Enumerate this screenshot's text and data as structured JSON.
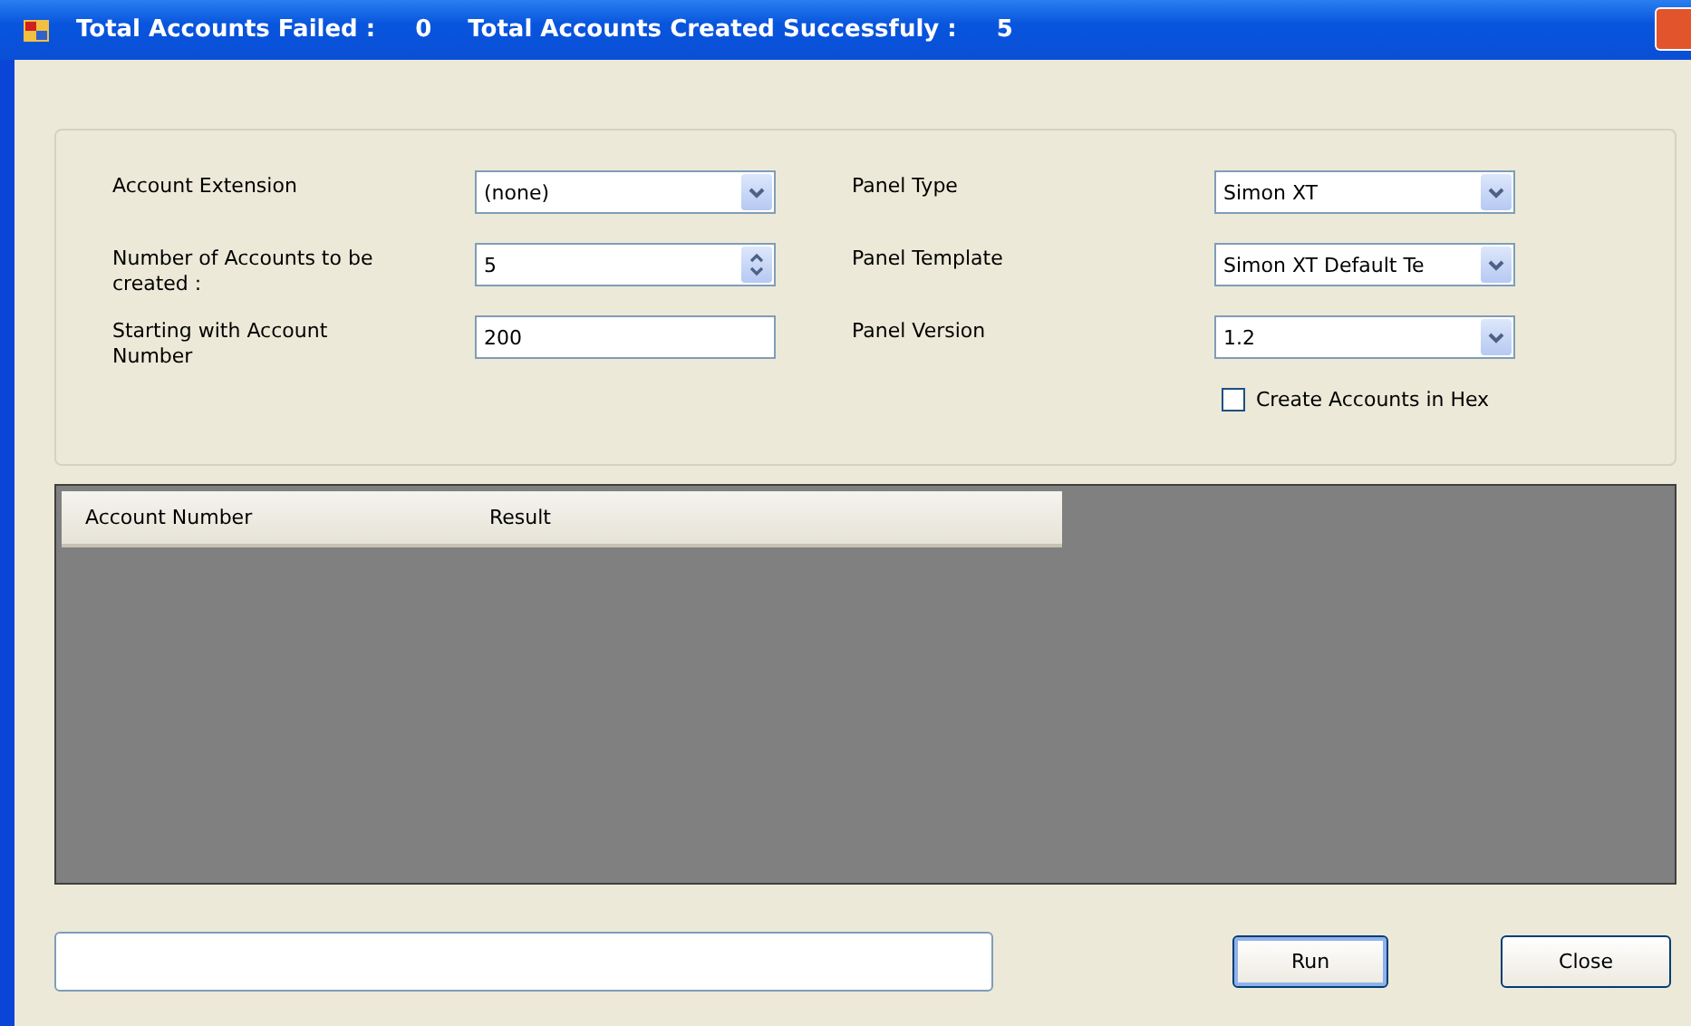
{
  "window": {
    "failed_label": "Total Accounts Failed :",
    "failed_count": "0",
    "created_label": "Total Accounts Created Successfuly :",
    "created_count": "5"
  },
  "left_fields": [
    {
      "label": "Account Extension",
      "kind": "combo",
      "value": "(none)"
    },
    {
      "label": "Number of Accounts to be created :",
      "kind": "spin",
      "value": "5"
    },
    {
      "label": "Starting with Account Number",
      "kind": "text",
      "value": "200"
    }
  ],
  "right_fields": [
    {
      "label": "Panel Type",
      "kind": "combo",
      "value": "Simon XT"
    },
    {
      "label": "Panel Template",
      "kind": "combo",
      "value": "Simon XT Default Te"
    },
    {
      "label": "Panel Version",
      "kind": "combo",
      "value": "1.2"
    }
  ],
  "hex_checkbox": {
    "label": "Create Accounts in Hex",
    "checked": false
  },
  "results_table": {
    "columns": [
      "Account Number",
      "Result"
    ]
  },
  "buttons": [
    {
      "label": "Run",
      "default": true
    },
    {
      "label": "Close",
      "default": false
    }
  ]
}
